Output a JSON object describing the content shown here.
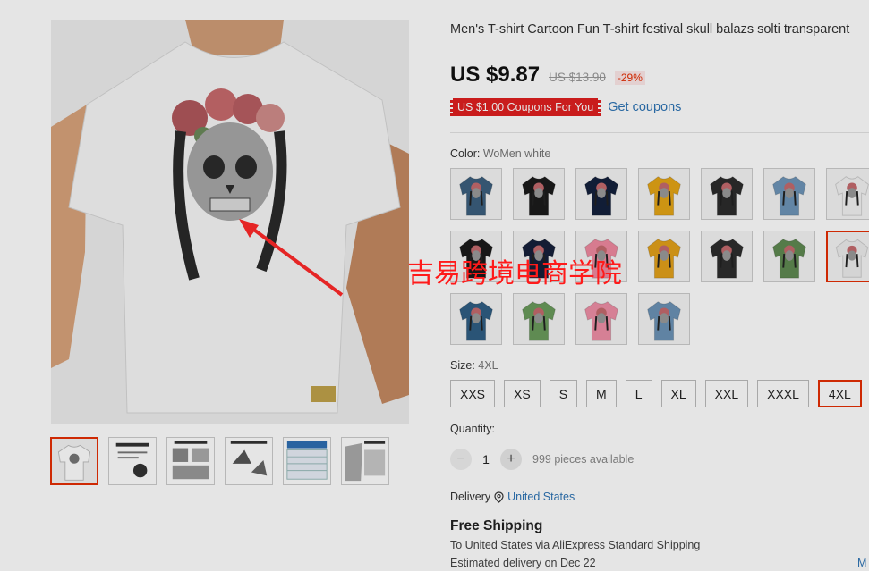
{
  "product": {
    "title": "Men's T-shirt Cartoon Fun T-shirt festival skull balazs solti transparent",
    "price": "US $9.87",
    "old_price": "US $13.90",
    "discount": "-29%",
    "coupon_badge": "US $1.00 Coupons For You",
    "coupon_link": "Get coupons"
  },
  "watermark": "吉易跨境电商学院",
  "color": {
    "label": "Color:",
    "selected": "WoMen white",
    "swatches": [
      {
        "shirt": "#3b5f7e"
      },
      {
        "shirt": "#1b1b1b"
      },
      {
        "shirt": "#14213d"
      },
      {
        "shirt": "#e5a516"
      },
      {
        "shirt": "#2c2c2c"
      },
      {
        "shirt": "#6e95b8"
      },
      {
        "shirt": "#f2f2f2"
      },
      {
        "shirt": "#1a1a1a"
      },
      {
        "shirt": "#16203a"
      },
      {
        "shirt": "#f08aa0"
      },
      {
        "shirt": "#e3a11a"
      },
      {
        "shirt": "#2d2d2d"
      },
      {
        "shirt": "#5f8a52"
      },
      {
        "shirt": "#ededed"
      },
      {
        "shirt": "#2f5e84"
      },
      {
        "shirt": "#6a9b5c"
      },
      {
        "shirt": "#ef8fa6"
      },
      {
        "shirt": "#6b92b6"
      }
    ],
    "selected_index": 13
  },
  "size": {
    "label": "Size:",
    "selected": "4XL",
    "options": [
      "XXS",
      "XS",
      "S",
      "M",
      "L",
      "XL",
      "XXL",
      "XXXL",
      "4XL"
    ]
  },
  "quantity": {
    "label": "Quantity:",
    "minus": "−",
    "value": "1",
    "plus": "+",
    "available": "999 pieces available"
  },
  "delivery": {
    "label": "Delivery",
    "country": "United States"
  },
  "shipping": {
    "title": "Free Shipping",
    "line1": "To United States via AliExpress Standard Shipping",
    "line2": "Estimated delivery on Dec 22",
    "more": "M"
  },
  "colors": {
    "accent": "#e62e04",
    "link": "#2e74b5",
    "coupon": "#e02020"
  }
}
